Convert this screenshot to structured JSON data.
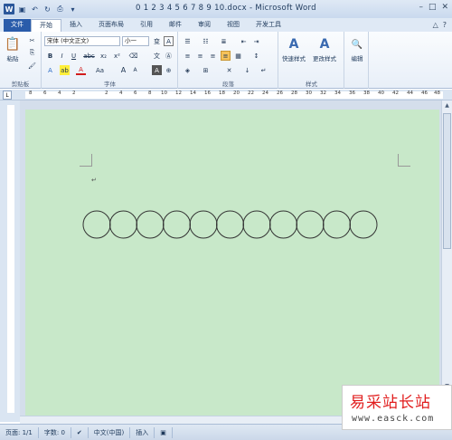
{
  "window": {
    "title": "0 1 2 3 4 5 6 7 8 9 10.docx - Microsoft Word",
    "controls": [
      "–",
      "□",
      "✕"
    ]
  },
  "qat": {
    "icons": [
      "word-logo",
      "save-icon",
      "undo-icon",
      "redo-icon",
      "print-preview-icon",
      "customize-icon"
    ]
  },
  "tabs": [
    "文件",
    "开始",
    "插入",
    "页面布局",
    "引用",
    "邮件",
    "审阅",
    "视图",
    "开发工具"
  ],
  "ribbon": {
    "clipboard": {
      "paste": "粘贴",
      "label": "剪贴板"
    },
    "font": {
      "font_name": "宋体 (中文正文)",
      "font_size": "小一",
      "label": "字体",
      "buttons": [
        "B",
        "I",
        "U",
        "abc",
        "x₂",
        "x²",
        "A",
        "Aa",
        "A",
        "A"
      ]
    },
    "paragraph": {
      "label": "段落"
    },
    "styles": {
      "quick_styles": "快速样式",
      "change_styles": "更改样式",
      "label": "样式"
    },
    "editing": {
      "label": "编辑"
    }
  },
  "ruler": {
    "numbers": [
      "8",
      "6",
      "4",
      "2",
      "2",
      "4",
      "6",
      "8",
      "10",
      "12",
      "14",
      "16",
      "18",
      "20",
      "22",
      "24",
      "26",
      "28",
      "30",
      "32",
      "34",
      "36",
      "38",
      "40",
      "42",
      "44",
      "46",
      "48"
    ]
  },
  "document": {
    "paragraph_mark": "↵",
    "circles_count": 11,
    "page_color": "#c8e8c9"
  },
  "statusbar": {
    "page": "页面: 1/1",
    "words": "字数: 0",
    "language": "中文(中国)",
    "mode": "插入"
  },
  "watermark": {
    "brand": "易采站长站",
    "url": "www.easck.com"
  }
}
